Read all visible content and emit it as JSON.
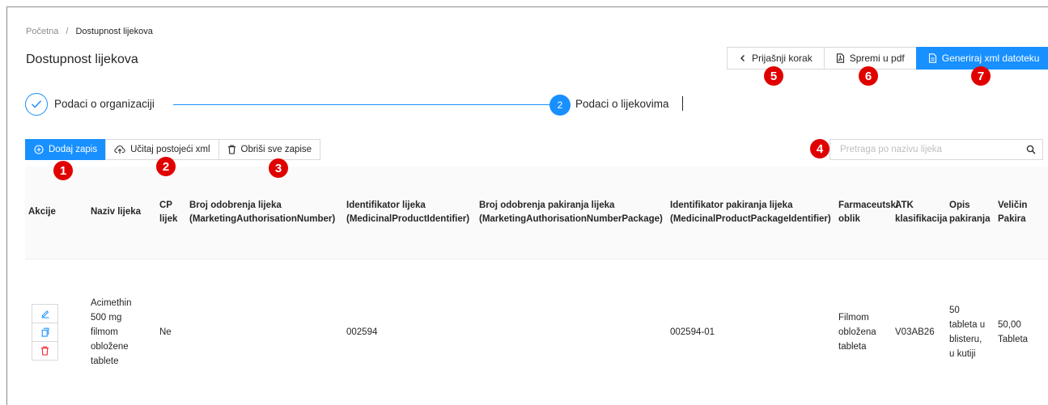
{
  "breadcrumb": {
    "home": "Početna",
    "separator": "/",
    "current": "Dostupnost lijekova"
  },
  "page_title": "Dostupnost lijekova",
  "top_actions": {
    "back": "Prijašnji korak",
    "pdf": "Spremi u pdf",
    "xml": "Generiraj xml datoteku"
  },
  "steps": [
    {
      "label": "Podaci o organizaciji",
      "status": "done"
    },
    {
      "number": "2",
      "label": "Podaci o lijekovima",
      "status": "active"
    }
  ],
  "toolbar": {
    "add": "Dodaj zapis",
    "load": "Učitaj postojeći xml",
    "delete_all": "Obriši sve zapise"
  },
  "search": {
    "placeholder": "Pretraga po nazivu lijeka",
    "value": ""
  },
  "badges": [
    "1",
    "2",
    "3",
    "4",
    "5",
    "6",
    "7"
  ],
  "colors": {
    "primary": "#1890ff",
    "badge": "#e00000",
    "danger": "#f5222d",
    "header_bg": "#fafafa"
  },
  "table": {
    "columns": [
      {
        "line1": "Akcije",
        "line2": ""
      },
      {
        "line1": "Naziv lijeka",
        "line2": ""
      },
      {
        "line1": "CP",
        "line2": "lijek"
      },
      {
        "line1": "Broj odobrenja lijeka",
        "line2": "(MarketingAuthorisationNumber)"
      },
      {
        "line1": "Identifikator lijeka",
        "line2": "(MedicinalProductIdentifier)"
      },
      {
        "line1": "Broj odobrenja pakiranja lijeka",
        "line2": "(MarketingAuthorisationNumberPackage)"
      },
      {
        "line1": "Identifikator pakiranja lijeka",
        "line2": "(MedicinalProductPackageIdentifier)"
      },
      {
        "line1": "Farmaceutski",
        "line2": "oblik"
      },
      {
        "line1": "ATK",
        "line2": "klasifikacija"
      },
      {
        "line1": "Opis",
        "line2": "pakiranja"
      },
      {
        "line1": "Veličin",
        "line2": "Pakira"
      }
    ],
    "rows": [
      {
        "naziv": [
          "Acimethin",
          "500 mg",
          "filmom",
          "obložene",
          "tablete"
        ],
        "cp": "Ne",
        "broj_odobrenja": "",
        "identifikator": "002594",
        "broj_pakiranja": "",
        "identifikator_pakiranja": "002594-01",
        "oblik": [
          "Filmom",
          "obložena",
          "tableta"
        ],
        "atk": "V03AB26",
        "opis": [
          "50",
          "tableta u",
          "blisteru,",
          "u kutiji"
        ],
        "velicina": [
          "50,00",
          "Tableta"
        ]
      }
    ]
  }
}
